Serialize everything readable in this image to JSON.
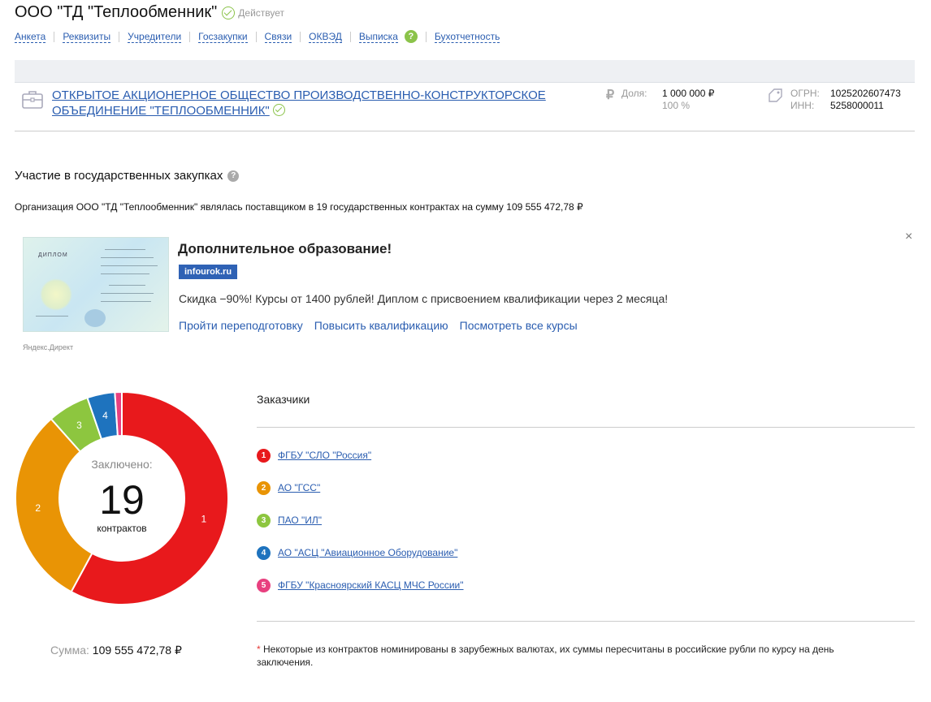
{
  "header": {
    "title": "ООО \"ТД \"Теплообменник\"",
    "status": "Действует"
  },
  "nav": {
    "items": [
      "Анкета",
      "Реквизиты",
      "Учредители",
      "Госзакупки",
      "Связи",
      "ОКВЭД",
      "Выписка",
      "Бухотчетность"
    ]
  },
  "founder": {
    "name": "ОТКРЫТОЕ АКЦИОНЕРНОЕ ОБЩЕСТВО ПРОИЗВОДСТВЕННО-КОНСТРУКТОРСКОЕ ОБЪЕДИНЕНИЕ \"ТЕПЛООБМЕННИК\"",
    "share_label": "Доля:",
    "share_value": "1 000 000 ₽",
    "share_percent": "100 %",
    "ogrn_label": "ОГРН:",
    "ogrn_value": "1025202607473",
    "inn_label": "ИНН:",
    "inn_value": "5258000011"
  },
  "procurement": {
    "title": "Участие в государственных закупках",
    "text": "Организация ООО \"ТД \"Теплообменник\" являлась поставщиком в 19 государственных контрактах на сумму 109 555 472,78 ₽"
  },
  "ad": {
    "image_text": "ДИПЛОМ",
    "heading": "Дополнительное образование!",
    "badge": "infourok.ru",
    "description": "Скидка −90%! Курсы от 1400 рублей! Диплом с присвоением квалификации через 2 месяца!",
    "links": [
      "Пройти переподготовку",
      "Повысить квалификацию",
      "Посмотреть все курсы"
    ],
    "source": "Яндекс.Директ",
    "close": "×"
  },
  "chart_data": {
    "type": "pie",
    "center_label": "Заключено:",
    "center_value": "19",
    "center_sub": "контрактов",
    "slices": [
      {
        "label": "1",
        "value": 11,
        "color": "#e8191c"
      },
      {
        "label": "2",
        "value": 5.8,
        "color": "#e99405"
      },
      {
        "label": "3",
        "value": 1.2,
        "color": "#8dc63f"
      },
      {
        "label": "4",
        "value": 0.8,
        "color": "#1e73be"
      },
      {
        "label": "5",
        "value": 0.2,
        "color": "#e8407f"
      }
    ]
  },
  "sum": {
    "label": "Сумма:",
    "value": "109 555 472,78 ₽"
  },
  "customers": {
    "title": "Заказчики",
    "items": [
      {
        "num": "1",
        "name": "ФГБУ \"СЛО \"Россия\"",
        "color": "#e8191c"
      },
      {
        "num": "2",
        "name": "АО \"ГСС\"",
        "color": "#e99405"
      },
      {
        "num": "3",
        "name": "ПАО \"ИЛ\"",
        "color": "#8dc63f"
      },
      {
        "num": "4",
        "name": "АО \"АСЦ \"Авиационное Оборудование\"",
        "color": "#1e73be"
      },
      {
        "num": "5",
        "name": "ФГБУ \"Красноярский КАСЦ МЧС России\"",
        "color": "#e8407f"
      }
    ],
    "note_mark": "*",
    "note": "Некоторые из контрактов номинированы в зарубежных валютах, их суммы пересчитаны в российские рубли по курсу на день заключения."
  }
}
